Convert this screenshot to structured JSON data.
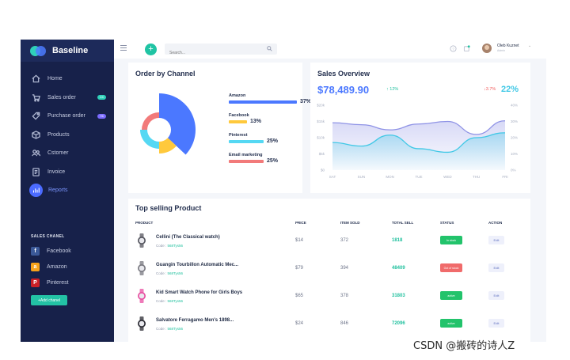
{
  "brand": {
    "name": "Baseline"
  },
  "sidebar": {
    "items": [
      {
        "label": "Home",
        "icon": "home-icon"
      },
      {
        "label": "Sales order",
        "icon": "cart-icon",
        "badge": "24",
        "badge_color": "#2fd0b9"
      },
      {
        "label": "Purchase order",
        "icon": "tag-icon",
        "badge": "76",
        "badge_color": "#7b6bff"
      },
      {
        "label": "Products",
        "icon": "box-icon"
      },
      {
        "label": "Cstomer",
        "icon": "users-icon"
      },
      {
        "label": "Invoice",
        "icon": "invoice-icon"
      },
      {
        "label": "Reports",
        "icon": "chart-icon",
        "active": true
      }
    ],
    "sales_channel_heading": "SALES CHANEL",
    "channels": [
      {
        "label": "Facebook",
        "glyph": "f",
        "color": "#3b5998"
      },
      {
        "label": "Amazon",
        "glyph": "a",
        "color": "#f7a21b"
      },
      {
        "label": "Pinterest",
        "glyph": "P",
        "color": "#cb2027"
      }
    ],
    "add_channel_label": "+Add chanel"
  },
  "topbar": {
    "search_placeholder": "Search...",
    "user_name": "Oleb Kuznet",
    "user_role": "Admin"
  },
  "order_by_channel": {
    "title": "Order by Channel",
    "channels": [
      {
        "label": "Amazon",
        "percent": "37%",
        "color": "#4b78ff",
        "value": 37
      },
      {
        "label": "Facebook",
        "percent": "13%",
        "color": "#ffc93c",
        "value": 13
      },
      {
        "label": "Pinterest",
        "percent": "25%",
        "color": "#55d8f3",
        "value": 25
      },
      {
        "label": "Email marketing",
        "percent": "25%",
        "color": "#f27a7a",
        "value": 25
      }
    ]
  },
  "sales_overview": {
    "title": "Sales Overview",
    "total": "$78,489.90",
    "change_up": "12%",
    "change_down": "3.7%",
    "right_percent": "22%",
    "colors": {
      "up": "#22c19f",
      "down": "#f25c5c",
      "accent": "#4b78ff",
      "rate": "#40c8e6"
    }
  },
  "chart_data": {
    "type": "area",
    "x": [
      "SAT",
      "SUN",
      "MON",
      "TUE",
      "WED",
      "THU",
      "FRI"
    ],
    "y_left_ticks": [
      "$20k",
      "$15k",
      "$10k",
      "$5k",
      "$0"
    ],
    "y_right_ticks": [
      "40%",
      "30%",
      "20%",
      "10%",
      "0%"
    ],
    "ylim_left": [
      0,
      20
    ],
    "ylim_right": [
      0,
      40
    ],
    "series": [
      {
        "values": [
          14.6,
          14.0,
          12.4,
          14.2,
          15.0,
          11.0,
          15.2
        ],
        "color": "#8f93e6"
      },
      {
        "values": [
          8.5,
          7.4,
          10.8,
          6.6,
          5.5,
          10.0,
          11.5
        ],
        "color": "#40c8e6"
      }
    ]
  },
  "top_selling": {
    "title": "Top selling Product",
    "headers": [
      "PRODUCT",
      "PRICE",
      "ITEM SOLD",
      "TOTAL SELL",
      "STATUS",
      "ACTION"
    ],
    "rows": [
      {
        "name": "Cellini (The Classical watch)",
        "code_label": "Code : ",
        "code": "568Tys56",
        "price": "$14",
        "sold": "372",
        "total": "1818",
        "status": "In stock",
        "status_color": "#22c36b",
        "action": "Edit",
        "thumb": "#55565f"
      },
      {
        "name": "Guangin Tourbillon Automatic Mec...",
        "code_label": "Code : ",
        "code": "568Tys56",
        "price": "$79",
        "sold": "394",
        "total": "48409",
        "status": "Out of stock",
        "status_color": "#f06b6b",
        "action": "Edit",
        "thumb": "#7a7a82"
      },
      {
        "name": "Kid Smart Watch Phone for Girls Boys",
        "code_label": "Code : ",
        "code": "568Tys56",
        "price": "$65",
        "sold": "378",
        "total": "31803",
        "status": "active",
        "status_color": "#22c36b",
        "action": "Edit",
        "thumb": "#e84fa1"
      },
      {
        "name": "Salvatore Ferragamo Men's 1898...",
        "code_label": "Code : ",
        "code": "568Tys56",
        "price": "$24",
        "sold": "846",
        "total": "72096",
        "status": "active",
        "status_color": "#22c36b",
        "action": "Edit",
        "thumb": "#2b2b33"
      }
    ]
  },
  "watermark": "CSDN @搬砖的诗人Z"
}
